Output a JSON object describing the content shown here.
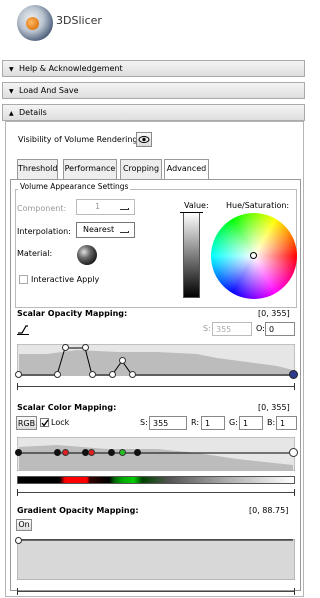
{
  "app": {
    "title": "3DSlicer"
  },
  "sections": {
    "help": "Help & Acknowledgement",
    "load": "Load And Save",
    "details": "Details"
  },
  "details": {
    "visibility_label": "Visibility of Volume Rendering:",
    "visibility_icon": "eye-icon",
    "tabs": [
      "Threshold",
      "Performance",
      "Cropping",
      "Advanced"
    ],
    "active_tab": "Advanced"
  },
  "appearance": {
    "group_title": "Volume Appearance Settings",
    "component_label": "Component:",
    "component_value": "1",
    "interpolation_label": "Interpolation:",
    "interpolation_value": "Nearest",
    "material_label": "Material:",
    "interactive_apply_label": "Interactive Apply",
    "value_label": "Value:",
    "hue_label": "Hue/Saturation:"
  },
  "scalar_opacity": {
    "title": "Scalar Opacity Mapping:",
    "range": "[0, 355]",
    "s_label": "S:",
    "s_value": "355",
    "o_label": "O:",
    "o_value": "0"
  },
  "scalar_color": {
    "title": "Scalar Color Mapping:",
    "range": "[0, 355]",
    "rgb_button": "RGB",
    "lock_label": "Lock",
    "s_label": "S:",
    "s_value": "355",
    "r_label": "R:",
    "r_value": "1",
    "g_label": "G:",
    "g_value": "1",
    "b_label": "B:",
    "b_value": "1"
  },
  "gradient_opacity": {
    "title": "Gradient Opacity Mapping:",
    "range": "[0, 88.75]",
    "on_button": "On"
  },
  "colors": {
    "accent_blue": "#2f3c8f",
    "color_red": "#e02020",
    "color_green": "#22c022"
  }
}
